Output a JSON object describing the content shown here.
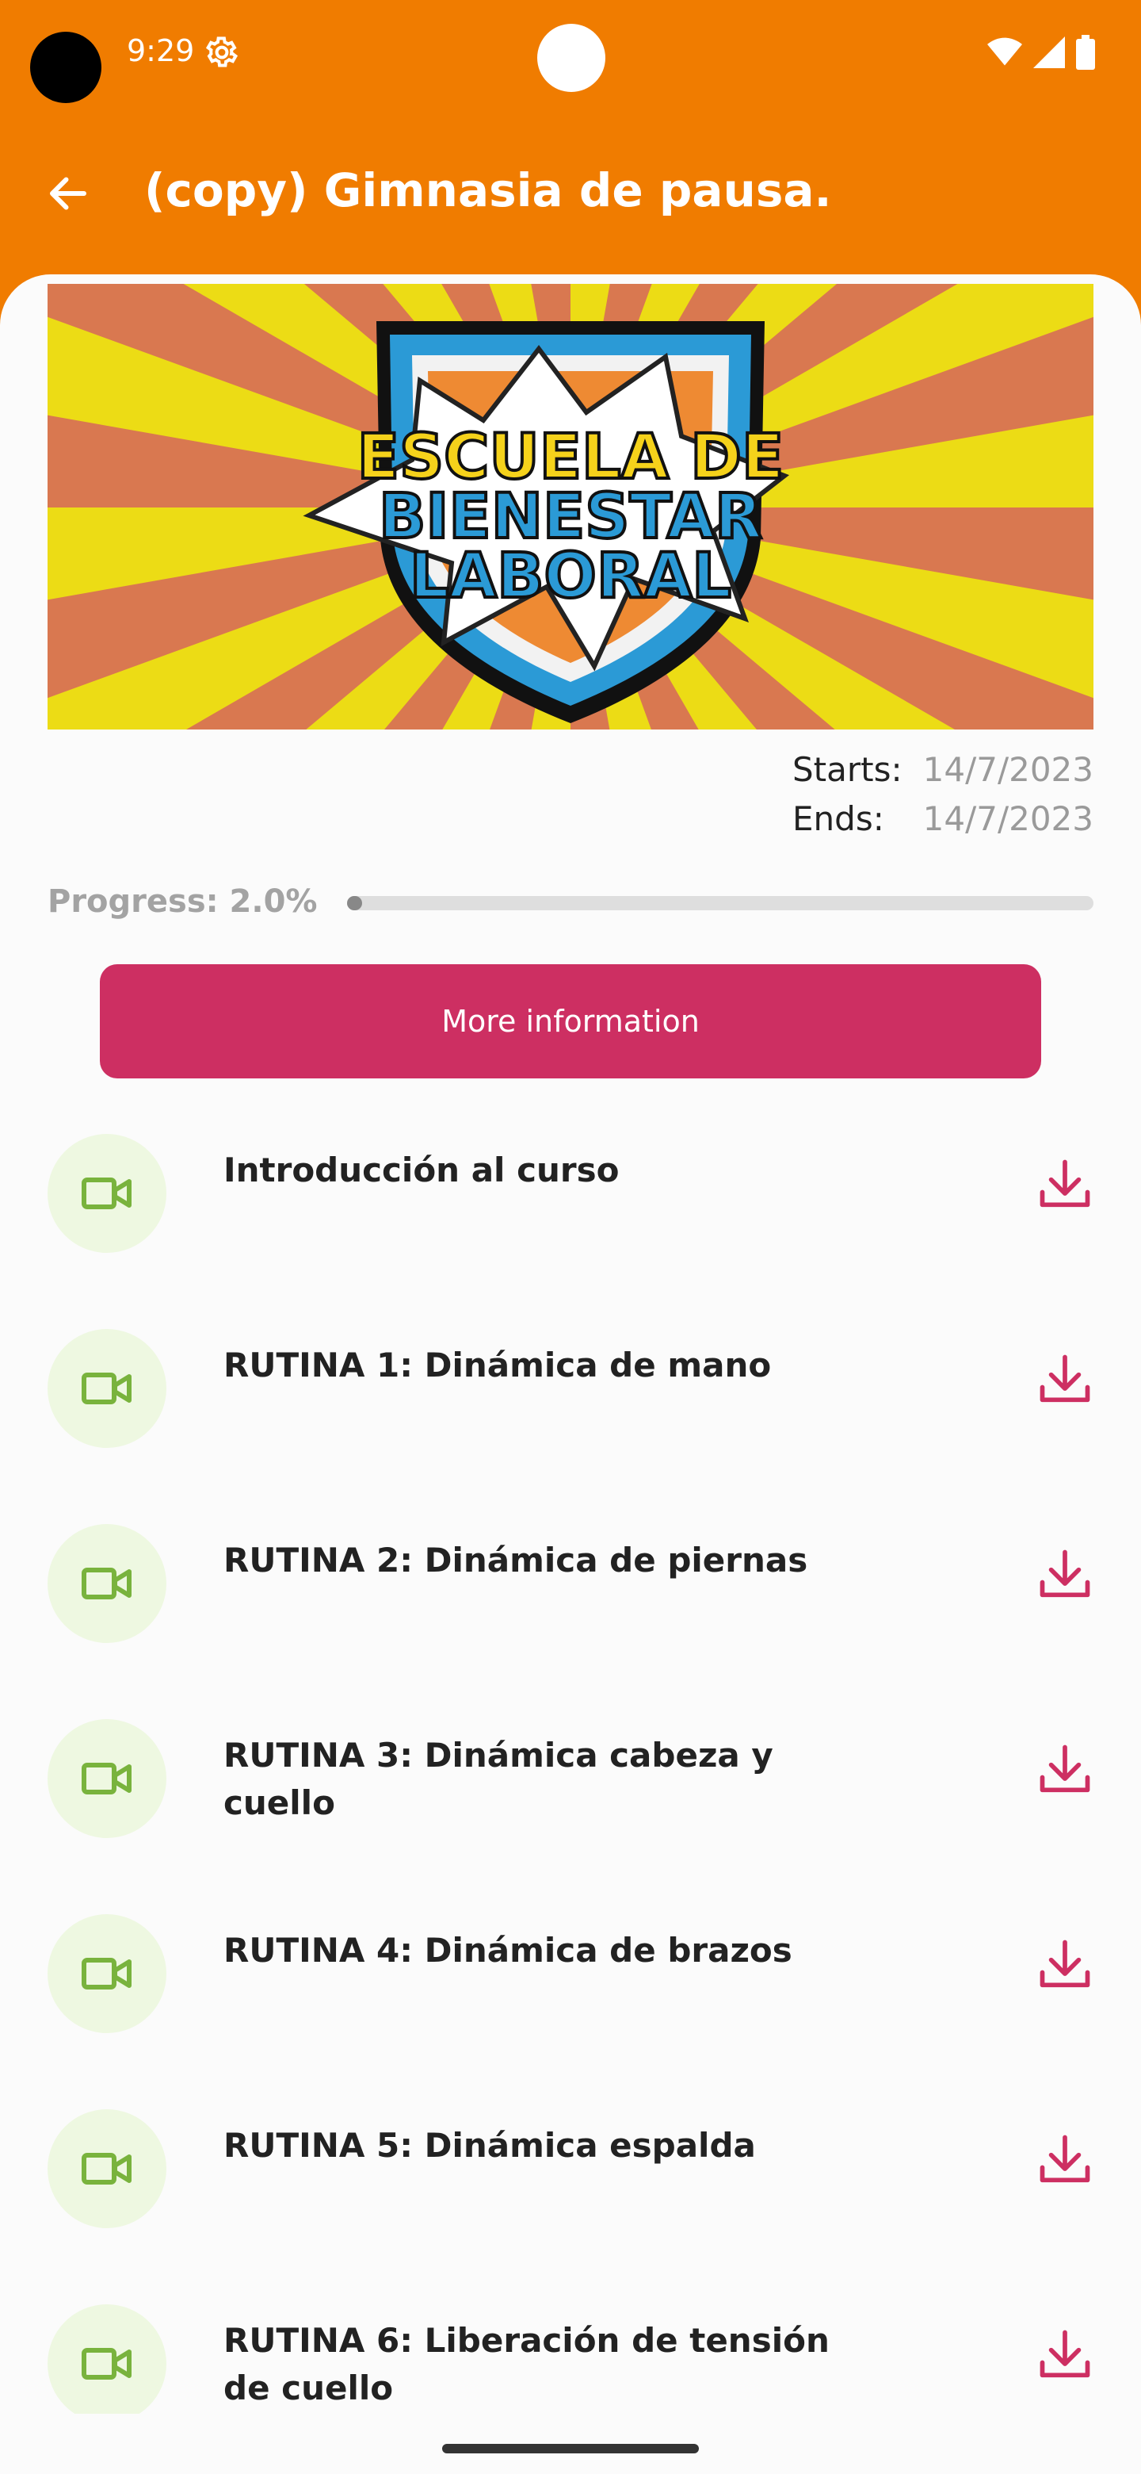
{
  "status_bar": {
    "time": "9:29",
    "icons": [
      "settings-gear-icon",
      "wifi-icon",
      "signal-icon",
      "battery-icon"
    ]
  },
  "app_bar": {
    "back_icon": "arrow-left-icon",
    "title": "(copy) Gimnasia de pausa."
  },
  "banner": {
    "image_alt": "Escuela de Bienestar Laboral badge banner",
    "lines": [
      "ESCUELA DE",
      "BIENESTAR",
      "LABORAL"
    ]
  },
  "dates": {
    "starts_label": "Starts:",
    "starts_value": "14/7/2023",
    "ends_label": "Ends:",
    "ends_value": "14/7/2023"
  },
  "progress": {
    "label": "Progress: 2.0%",
    "value": 0.02
  },
  "more_info_button": "More information",
  "lessons": [
    {
      "title": "Introducción al curso",
      "icon": "video-camera-icon",
      "action_icon": "download-icon"
    },
    {
      "title": "RUTINA 1: Dinámica de mano",
      "icon": "video-camera-icon",
      "action_icon": "download-icon"
    },
    {
      "title": "RUTINA 2: Dinámica de piernas",
      "icon": "video-camera-icon",
      "action_icon": "download-icon"
    },
    {
      "title": "RUTINA 3: Dinámica cabeza y cuello",
      "icon": "video-camera-icon",
      "action_icon": "download-icon"
    },
    {
      "title": "RUTINA 4: Dinámica de brazos",
      "icon": "video-camera-icon",
      "action_icon": "download-icon"
    },
    {
      "title": "RUTINA 5: Dinámica espalda",
      "icon": "video-camera-icon",
      "action_icon": "download-icon"
    },
    {
      "title": "RUTINA 6: Liberación de tensión de cuello",
      "icon": "video-camera-icon",
      "action_icon": "download-icon"
    }
  ],
  "colors": {
    "app_bar": "#f07c00",
    "accent": "#cd2f62",
    "icon_green": "#79b33d",
    "icon_bg": "#eef8e1"
  }
}
